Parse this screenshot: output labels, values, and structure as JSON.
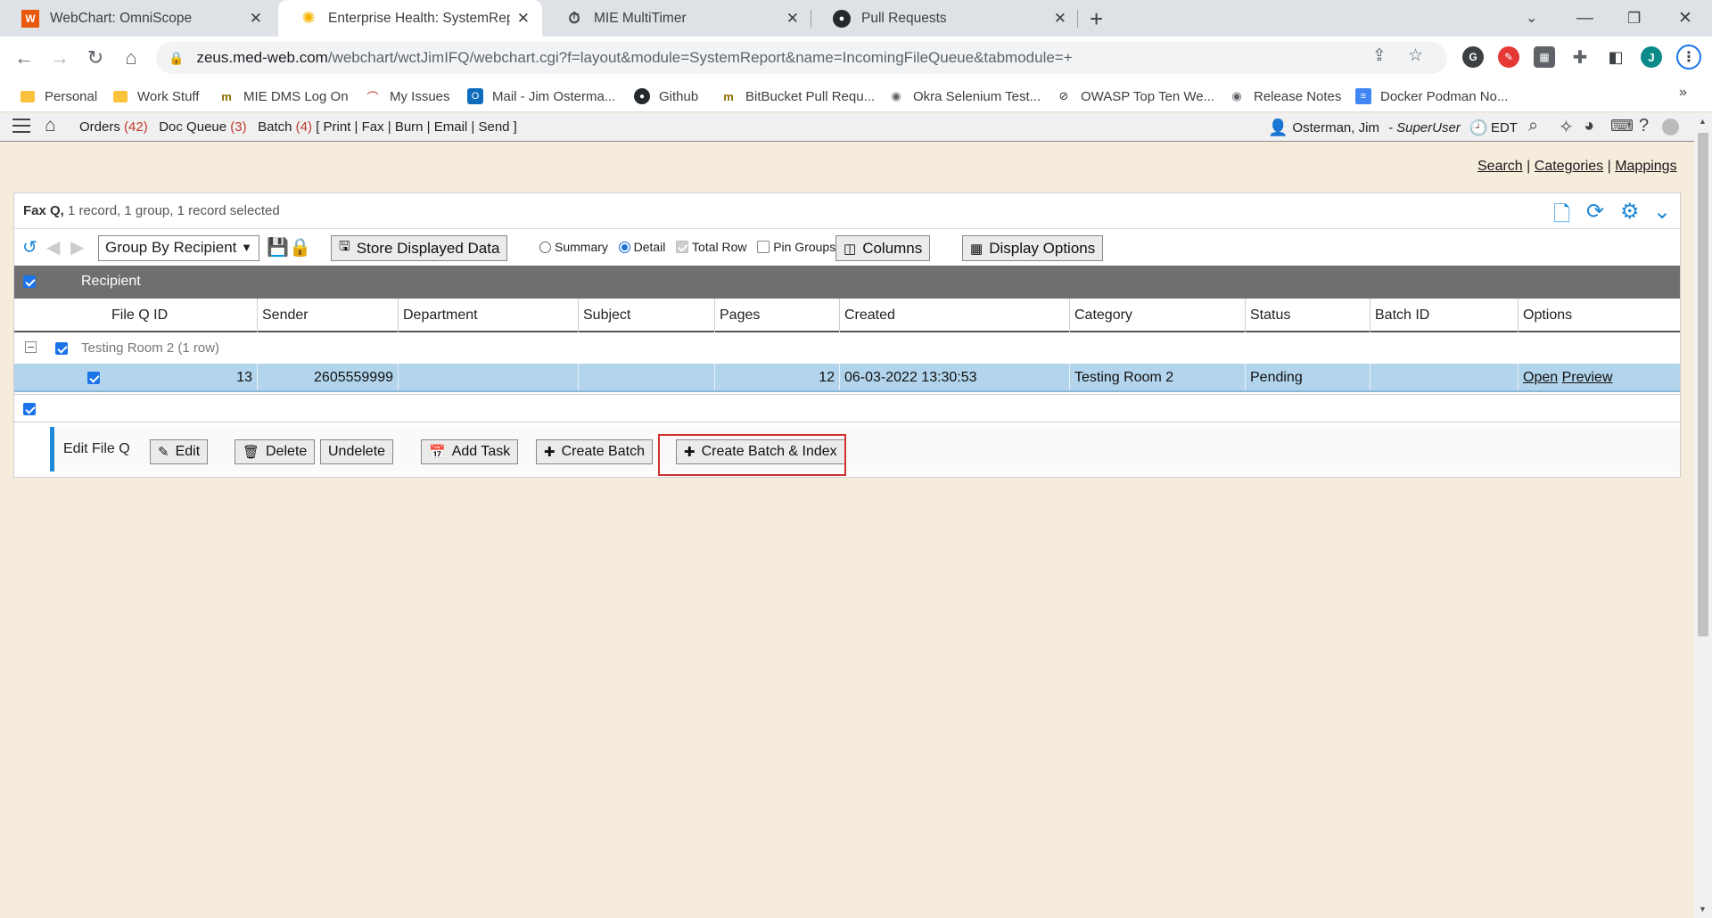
{
  "browser": {
    "tabs": [
      {
        "title": "WebChart: OmniScope",
        "icon": "webchart-w-icon"
      },
      {
        "title": "Enterprise Health: SystemReport",
        "icon": "sun-gear-icon",
        "active": true
      },
      {
        "title": "MIE MultiTimer",
        "icon": "stopwatch-icon"
      },
      {
        "title": "Pull Requests",
        "icon": "github-icon"
      }
    ],
    "url_host": "zeus.med-web.com",
    "url_path": "/webchart/wctJimIFQ/webchart.cgi?f=layout&module=SystemReport&name=IncomingFileQueue&tabmodule=+",
    "profile_initial": "J",
    "bookmarks": [
      {
        "label": "Personal",
        "icon": "folder-icon"
      },
      {
        "label": "Work Stuff",
        "icon": "folder-icon"
      },
      {
        "label": "MIE DMS Log On",
        "icon": "mie-logo-icon"
      },
      {
        "label": "My Issues",
        "icon": "redmine-icon"
      },
      {
        "label": "Mail - Jim Osterma...",
        "icon": "outlook-icon"
      },
      {
        "label": "Github",
        "icon": "github-icon"
      },
      {
        "label": "BitBucket Pull Requ...",
        "icon": "mie-logo-icon"
      },
      {
        "label": "Okra Selenium Test...",
        "icon": "globe-icon"
      },
      {
        "label": "OWASP Top Ten We...",
        "icon": "owasp-icon"
      },
      {
        "label": "Release Notes",
        "icon": "globe-icon"
      },
      {
        "label": "Docker Podman No...",
        "icon": "docs-icon"
      }
    ],
    "bookmarks_more": "»"
  },
  "appbar": {
    "orders_label": "Orders",
    "orders_count": "(42)",
    "docqueue_label": "Doc Queue",
    "docqueue_count": "(3)",
    "batch_label": "Batch",
    "batch_count": "(4)",
    "batch_actions": "[ Print | Fax | Burn | Email | Send ]",
    "user_name": "Osterman, Jim",
    "user_role": "- SuperUser",
    "timezone": "EDT"
  },
  "toplinks": {
    "search": "Search",
    "categories": "Categories",
    "mappings": "Mappings",
    "sep": "|"
  },
  "panel": {
    "title": "Fax Q,",
    "subtitle": "1 record, 1 group, 1 record selected",
    "group_by": "Group By Recipient",
    "store_button": "Store Displayed Data",
    "summary_label": "Summary",
    "detail_label": "Detail",
    "total_row_label": "Total Row",
    "pin_groups_label": "Pin Groups",
    "columns_button": "Columns",
    "display_options_button": "Display Options",
    "group_header": "Recipient",
    "columns": [
      "File Q ID",
      "Sender",
      "Department",
      "Subject",
      "Pages",
      "Created",
      "Category",
      "Status",
      "Batch ID",
      "Options"
    ],
    "group_label": "Testing Room 2  (1 row)",
    "rows": [
      {
        "file_q_id": "13",
        "sender": "2605559999",
        "department": "",
        "subject": "",
        "pages": "12",
        "created": "06-03-2022 13:30:53",
        "category": "Testing Room 2",
        "status": "Pending",
        "batch_id": "",
        "open": "Open",
        "preview": "Preview"
      }
    ]
  },
  "actions": {
    "label": "Edit File Q",
    "edit": "Edit",
    "delete": "Delete",
    "undelete": "Undelete",
    "add_task": "Add Task",
    "create_batch": "Create Batch",
    "create_batch_index": "Create Batch & Index"
  },
  "colors": {
    "accent": "#1e88d9",
    "highlight": "#d32f2f",
    "selected_row": "#b2d4ec",
    "group_bar": "#6f6f6f"
  }
}
